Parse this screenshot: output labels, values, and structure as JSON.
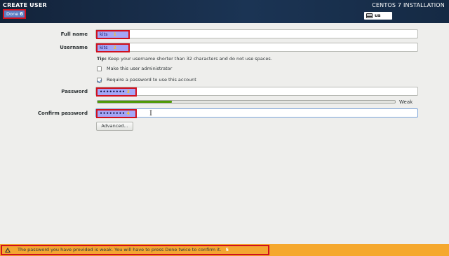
{
  "header": {
    "title": "CREATE USER",
    "done_label": "Done",
    "done_marker": "6",
    "install_title": "CENTOS 7 INSTALLATION",
    "keyboard_layout": "us"
  },
  "form": {
    "full_name_label": "Full name",
    "full_name_value": "kits",
    "full_name_marker": "1",
    "username_label": "Username",
    "username_value": "kits",
    "username_marker": "2",
    "tip_prefix": "Tip:",
    "tip_text": " Keep your username shorter than 32 characters and do not use spaces.",
    "admin_label": "Make this user administrator",
    "admin_checked": false,
    "require_pw_label": "Require a password to use this account",
    "require_pw_checked": true,
    "password_label": "Password",
    "password_value": "••••••••",
    "password_marker": "3",
    "strength_label": "Weak",
    "strength_fraction": 0.25,
    "confirm_label": "Confirm password",
    "confirm_value": "••••••••",
    "confirm_marker": "4",
    "advanced_label": "Advanced..."
  },
  "warning": {
    "text": "The password you have provided is weak. You will have to press Done twice to confirm it.",
    "marker": "5"
  },
  "colors": {
    "header_bg": "#1b3454",
    "highlight_border": "#d0101e",
    "highlight_fill": "#a4a6f7",
    "warning_bg": "#f5a82d",
    "strength_fill": "#4e9a06"
  }
}
